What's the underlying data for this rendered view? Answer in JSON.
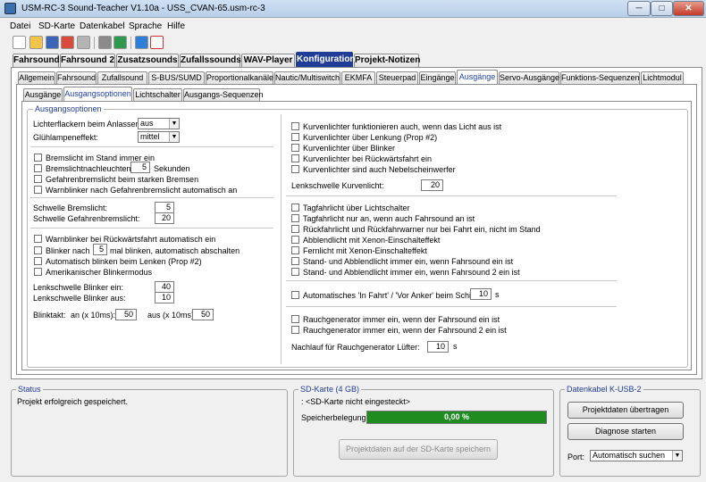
{
  "app": {
    "title": "USM-RC-3 Sound-Teacher V1.10a - USS_CVAN-65.usm-rc-3",
    "minimize": "─",
    "maximize": "□",
    "close": "✕"
  },
  "menu": [
    "Datei",
    "SD-Karte",
    "Datenkabel",
    "Sprache",
    "Hilfe"
  ],
  "toolbar_icons": [
    "new-file-icon",
    "open-folder-icon",
    "save-icon",
    "save-as-icon",
    "print-icon",
    "calculator-icon",
    "transfer-icon",
    "music-note-icon",
    "pdf-icon"
  ],
  "tabs_main": [
    "Fahrsound",
    "Fahrsound 2",
    "Zusatzsounds",
    "Zufallssounds",
    "WAV-Player",
    "Konfiguration",
    "Projekt-Notizen"
  ],
  "tabs_main_selected": "Konfiguration",
  "tabs_config": [
    "Allgemein",
    "Fahrsound",
    "Zufallsound",
    "S-BUS/SUMD",
    "Proportionalkanäle",
    "Nautic/Multiswitch",
    "EKMFA",
    "Steuerpad",
    "Eingänge",
    "Ausgänge",
    "Servo-Ausgänge",
    "Funktions-Sequenzen",
    "Lichtmodul"
  ],
  "tabs_config_selected": "Ausgänge",
  "tabs_sub": [
    "Ausgänge",
    "Ausgangsoptionen",
    "Lichtschalter",
    "Ausgangs-Sequenzen"
  ],
  "tabs_sub_selected": "Ausgangsoptionen",
  "group_title": "Ausgangsoptionen",
  "left": {
    "flicker_label": "Lichterflackern beim Anlassen:",
    "flicker_value": "aus",
    "glow_label": "Glühlampeneffekt:",
    "glow_value": "mittel",
    "brake_standing": "Bremslicht im Stand immer ein",
    "brake_after_pre": "Bremslichtnachleuchten:",
    "brake_after_value": "5",
    "brake_after_post": "Sekunden",
    "hazard_brake": "Gefahrenbremslicht beim starken Bremsen",
    "warn_after_hazard": "Warnblinker nach Gefahrenbremslicht automatisch an",
    "thr_brake_label": "Schwelle Bremslicht:",
    "thr_brake_value": "5",
    "thr_hazard_label": "Schwelle Gefahrenbremslicht:",
    "thr_hazard_value": "20",
    "warn_reverse": "Warnblinker bei Rückwärtsfahrt automatisch ein",
    "blink_after_pre": "Blinker nach",
    "blink_after_value": "5",
    "blink_after_post": "mal blinken, automatisch abschalten",
    "auto_blink_steer": "Automatisch blinken beim Lenken (Prop #2)",
    "american_blink": "Amerikanischer Blinkermodus",
    "steer_on_label": "Lenkschwelle Blinker ein:",
    "steer_on_value": "40",
    "steer_off_label": "Lenkschwelle Blinker aus:",
    "steer_off_value": "10",
    "blink_clock_label": "Blinktakt:",
    "an_label": "an (x 10ms):",
    "an_value": "50",
    "aus_label": "aus (x 10ms):",
    "aus_value": "50"
  },
  "right": {
    "curve1": "Kurvenlichter funktionieren auch, wenn das Licht aus ist",
    "curve2": "Kurvenlichter über Lenkung (Prop #2)",
    "curve3": "Kurvenlichter über Blinker",
    "curve4": "Kurvenlichter bei Rückwärtsfahrt ein",
    "curve5": "Kurvenlichter sind auch Nebelscheinwerfer",
    "curve_thr_label": "Lenkschwelle Kurvenlicht:",
    "curve_thr_value": "20",
    "day1": "Tagfahrlicht über Lichtschalter",
    "day2": "Tagfahrlicht nur an, wenn auch Fahrsound an ist",
    "day3": "Rückfahrlicht und Rückfahrwarner nur bei Fahrt ein, nicht im Stand",
    "day4": "Abblendlicht mit Xenon-Einschalteffekt",
    "day5": "Fernlicht mit Xenon-Einschalteffekt",
    "day6": "Stand- und Abblendlicht immer ein, wenn Fahrsound ein ist",
    "day7": "Stand- und Abblendlicht immer ein, wenn Fahrsound 2 ein ist",
    "ship_label": "Automatisches 'In Fahrt' / 'Vor Anker' beim Schiff:",
    "ship_value": "10",
    "ship_unit": "s",
    "smoke1": "Rauchgenerator immer ein, wenn der Fahrsound ein ist",
    "smoke2": "Rauchgenerator immer ein, wenn der Fahrsound 2 ein ist",
    "fan_label": "Nachlauf für Rauchgenerator Lüfter:",
    "fan_value": "10",
    "fan_unit": "s"
  },
  "status": {
    "title": "Status",
    "text": "Projekt erfolgreich gespeichert."
  },
  "sd": {
    "title": "SD-Karte (4 GB)",
    "line": ": <SD-Karte nicht eingesteckt>",
    "usage_label": "Speicherbelegung:",
    "usage_value": "0,00 %",
    "usage_fraction": 0,
    "save_btn": "Projektdaten auf der SD-Karte speichern"
  },
  "cable": {
    "title": "Datenkabel K-USB-2",
    "transfer_btn": "Projektdaten übertragen",
    "diag_btn": "Diagnose starten",
    "port_label": "Port:",
    "port_value": "Automatisch suchen"
  }
}
